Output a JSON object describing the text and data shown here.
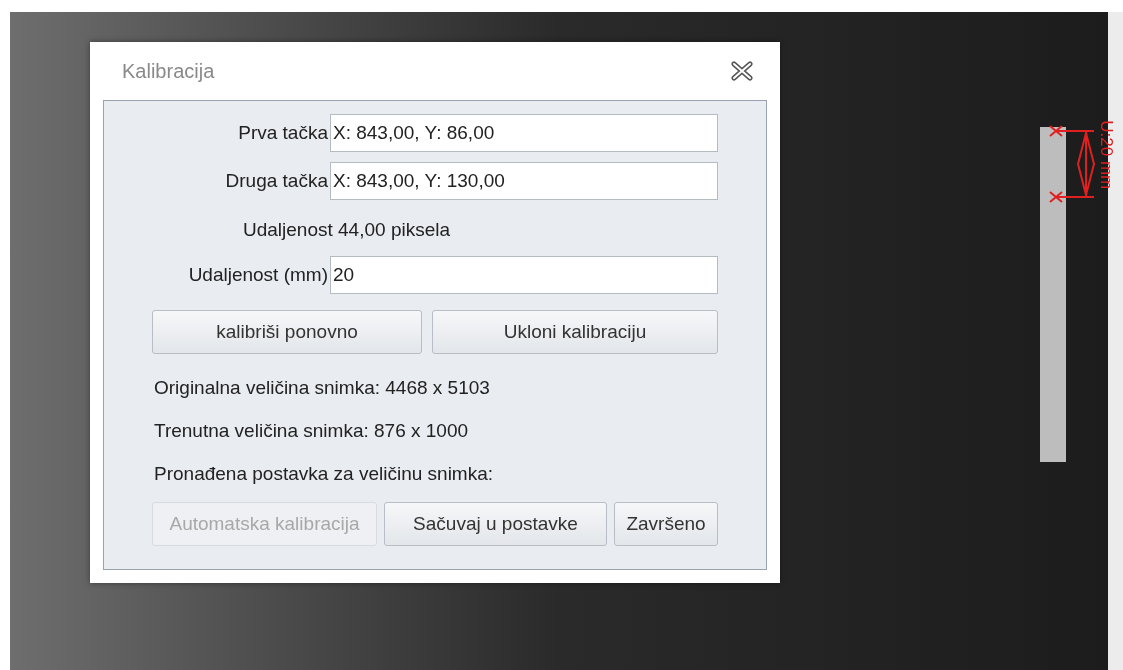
{
  "dialog": {
    "title": "Kalibracija",
    "point_fields": [
      {
        "label": "Prva tačka",
        "value": "X: 843,00, Y: 86,00"
      },
      {
        "label": "Druga tačka",
        "value": "X: 843,00, Y: 130,00"
      }
    ],
    "pixel_distance": "Udaljenost 44,00 piksela",
    "mm_field": {
      "label": "Udaljenost (mm)",
      "value": "20"
    },
    "action_buttons": [
      {
        "label": "kalibriši ponovno",
        "disabled": false
      },
      {
        "label": "Ukloni kalibraciju",
        "disabled": false
      }
    ],
    "info_lines": [
      "Originalna veličina snimka: 4468 x 5103",
      "Trenutna veličina snimka: 876 x 1000",
      "Pronađena postavka za veličinu snimka:"
    ],
    "bottom_buttons": [
      {
        "label": "Automatska kalibracija",
        "disabled": true
      },
      {
        "label": "Sačuvaj u postavke",
        "disabled": false
      },
      {
        "label": "Završeno",
        "disabled": false
      }
    ]
  },
  "measurement": {
    "label": "U:20 mm"
  }
}
